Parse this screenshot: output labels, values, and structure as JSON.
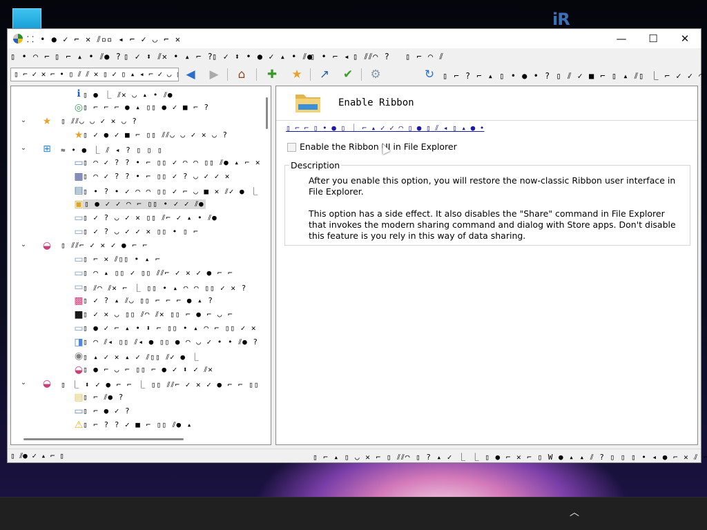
{
  "desktop": {
    "logo_text": "iR"
  },
  "window": {
    "title": "⸬ • ● ✓ ⌐ ✕ ⫽▫▫ ◂ ⌐ ✓ ◡ ⌐ ✕",
    "minimize": "—",
    "maximize": "☐",
    "close": "✕"
  },
  "menu": [
    "▯ • ◠ ⌐",
    "▯ ⌐ ▴ • ⫽● ?",
    "▯ ✓ ⬍ ⫽✕ • ▴ ⌐ ?",
    "▯ ✓ ⬍ • ● ✓ ▴ • ⫽●",
    "▯ • ⌐ ◂",
    "▯ ⫽⫽◠ ?",
    "▯ ⌐ ◠ ⫽"
  ],
  "toolbar": {
    "search_placeholder": "▯ ⌐ ✓ ✕ ⌐ • ▯ ⫽ ⫽ ✕ ▯ ✓ ▯ ▴ ◂ ⌐ ✓ ◡ ▯ ▯ ▯",
    "label": "▯ ⌐ ? ⌐ ▴ ▯ • ● • ? ▯ ⫽ ✓ ■ ⌐ ▯ ▴ ⫽▯ ⎿ ⌐ ✓ ✓ ◠ ▴ ?",
    "icons": [
      "back-icon",
      "forward-icon",
      "home-icon",
      "add-icon",
      "favorite-icon",
      "share-icon",
      "apply-icon",
      "settings-icon",
      "refresh-icon"
    ]
  },
  "tree": [
    {
      "label": "▯ ● ⎿ ⫽✕ ◡ ▴ • ⫽●",
      "level": 2,
      "icon": "info-icon"
    },
    {
      "label": "▯ ⌐ ⌐ ⌐ ● ▴ ▯▯ ● ✓ ■ ⌐ ?",
      "level": 2,
      "icon": "disc-icon"
    },
    {
      "label": "▯ ⫽⫽◡ ◡ ✓ ✕ ◡ ?",
      "level": 1,
      "icon": "star-icon",
      "expanded": true
    },
    {
      "label": "▯ ✓ ● ✓ ■ ⌐ ▯▯ ⫽⫽◡ ◡ ✓ ✕ ◡ ?",
      "level": 2,
      "icon": "star-icon"
    },
    {
      "label": "≈ • ● ⎿ ⫽ ◂ ? ▯ ▯ ▯",
      "level": 1,
      "icon": "windows-icon",
      "expanded": true
    },
    {
      "label": "▯ ◠ ✓ ? ? • ⌐ ▯▯ ✓ ◠ ◠ ▯▯ ⫽● ▴ ⌐ ✕ ▴ ▯▯ ⌐ ● ✓ ?",
      "level": 2,
      "icon": "taskbar-icon"
    },
    {
      "label": "▯ ◠ ✓ ? ? • ⌐ ▯▯ ✓ ? ◡ ✓ ✓ ✕",
      "level": 2,
      "icon": "start-icon"
    },
    {
      "label": "▯ • ? • ✓ ◠ ◠ ▯▯ ✓ ⌐ ◡ ■ ✕ ⫽✓ ● ⎿ ▯▯ ⫽⫽?",
      "level": 2,
      "icon": "chart-icon"
    },
    {
      "label": "▯ ● ✓ ✓ ◠ ⌐ ▯▯ • ✓ ✓ ⫽●",
      "level": 2,
      "icon": "explorer-icon",
      "selected": true
    },
    {
      "label": "▯ ✓ ? ◡ ✓ ✕ ▯▯ ⫽⌐ ✓ ▴ • ⫽●",
      "level": 2,
      "icon": "window-icon"
    },
    {
      "label": "▯ ✓ ? ◡ ✓ ✓ ✕ ▯▯ • ▯ ⌐",
      "level": 2,
      "icon": "window-icon"
    },
    {
      "label": "▯ ⫽⫽⌐ ✓ ✕ ✓ ● ⌐ ⌐",
      "level": 1,
      "icon": "rainbow-icon",
      "expanded": true
    },
    {
      "label": "▯ ⌐ ✕ ⫽▯▯ • ▴ ⌐",
      "level": 2,
      "icon": "window-icon"
    },
    {
      "label": "▯ ◠ ▴ ▯▯ ✓ ▯▯ ⫽⫽⌐ ✓ ✕ ✓ ● ⌐ ⌐",
      "level": 2,
      "icon": "window-icon"
    },
    {
      "label": "▯ ⫽◠ ⫽✕ ⌐ ⎿ ▯▯ • ▴ ◠ ◠ ▯▯ ✓ ✕ ?",
      "level": 2,
      "icon": "window-icon"
    },
    {
      "label": "▯ ✓ ? ▴ ⫽◡ ▯▯ ⌐ ⌐ ⌐ ● ▴ ?",
      "level": 2,
      "icon": "color-icon"
    },
    {
      "label": "▯ ✓ ✕ ◡ ▯▯ ⫽◠ ⫽✕ ▯▯ ⌐ ● ⌐ ◡ ⌐",
      "level": 2,
      "icon": "console-icon"
    },
    {
      "label": "▯ ● ✓ ⌐ ▴ • ⬍ ⌐ ▯▯ • ▴ ◠ ⌐ ▯▯ ✓ ✕ ? ▯▯ ⫽◠ ⫽✕",
      "level": 2,
      "icon": "window-icon"
    },
    {
      "label": "▯ ◠ ⫽◂ ▯▯ ⫽◂ ● ▯▯ ● ◠ ◡ ✓ • • ⫽● ?",
      "level": 2,
      "icon": "glass-icon"
    },
    {
      "label": "▯ ▴ ✓ ✕ ▴ ✓ ⫽▯▯ ⫽✓ ● ⎿",
      "level": 2,
      "icon": "mouse-icon"
    },
    {
      "label": "▯ ● ⌐ ◡ ⌐ ▯▯ ⌐ ● ✓ ⬍ ✓ ⫽✕",
      "level": 2,
      "icon": "rainbow-icon"
    },
    {
      "label": "▯ ⎿ ⬍ ✓ ● ⌐ ⌐ ⎿ ▯▯ ⫽⫽⌐ ✓ ✕ ✓ ● ⌐ ⌐ ▯▯ ⌐ ▴ ▴ • ●",
      "level": 1,
      "icon": "rainbow-icon",
      "expanded": true
    },
    {
      "label": "▯ ⌐ ⫽● ?",
      "level": 2,
      "icon": "folder-icon"
    },
    {
      "label": "▯ ⌐ ● ✓ ?",
      "level": 2,
      "icon": "taskbar-icon"
    },
    {
      "label": "▯ ⌐ ? ? ✓ ■ ⌐ ▯▯ ⫽● ▴",
      "level": 2,
      "icon": "warning-icon"
    }
  ],
  "detail": {
    "title": "Enable Ribbon",
    "link": "▯ ⌐ ⌐ ▯ • ● ▯ ⎿ ⌐ ▴ ✓ ✓ ◠ ▯ ● ▯ ⫽ ◂ ▯ ▴ ● •",
    "checkbox_label": "Enable the Ribbon UI in File Explorer",
    "checkbox_checked": false,
    "description_title": "Description",
    "description_p1": "After you enable this option, you will restore the now-classic Ribbon user interface in File Explorer.",
    "description_p2": "This option has a side effect. It also disables the \"Share\" command in File Explorer that invokes the modern sharing command and dialog with Store apps. Don't disable this feature is you rely in this way of data sharing."
  },
  "status": {
    "left": "▯ ⫽● ✓ ▴ ⌐ ▯",
    "right": "▯ ⌐ ▴ ▯ ◡ ✕ ⌐ ▯ ⫽⫽◠ ▯ ? ▴ ✓ ⎿ ⎿ ▯ ● ⌐ ✕ ⌐ ▯ W ● ▴ ▴ ⫽ ? ▯ ▯ ▯ • ◂ ● ⌐ ✕ ⫽ ⌐ ⫽◡"
  }
}
